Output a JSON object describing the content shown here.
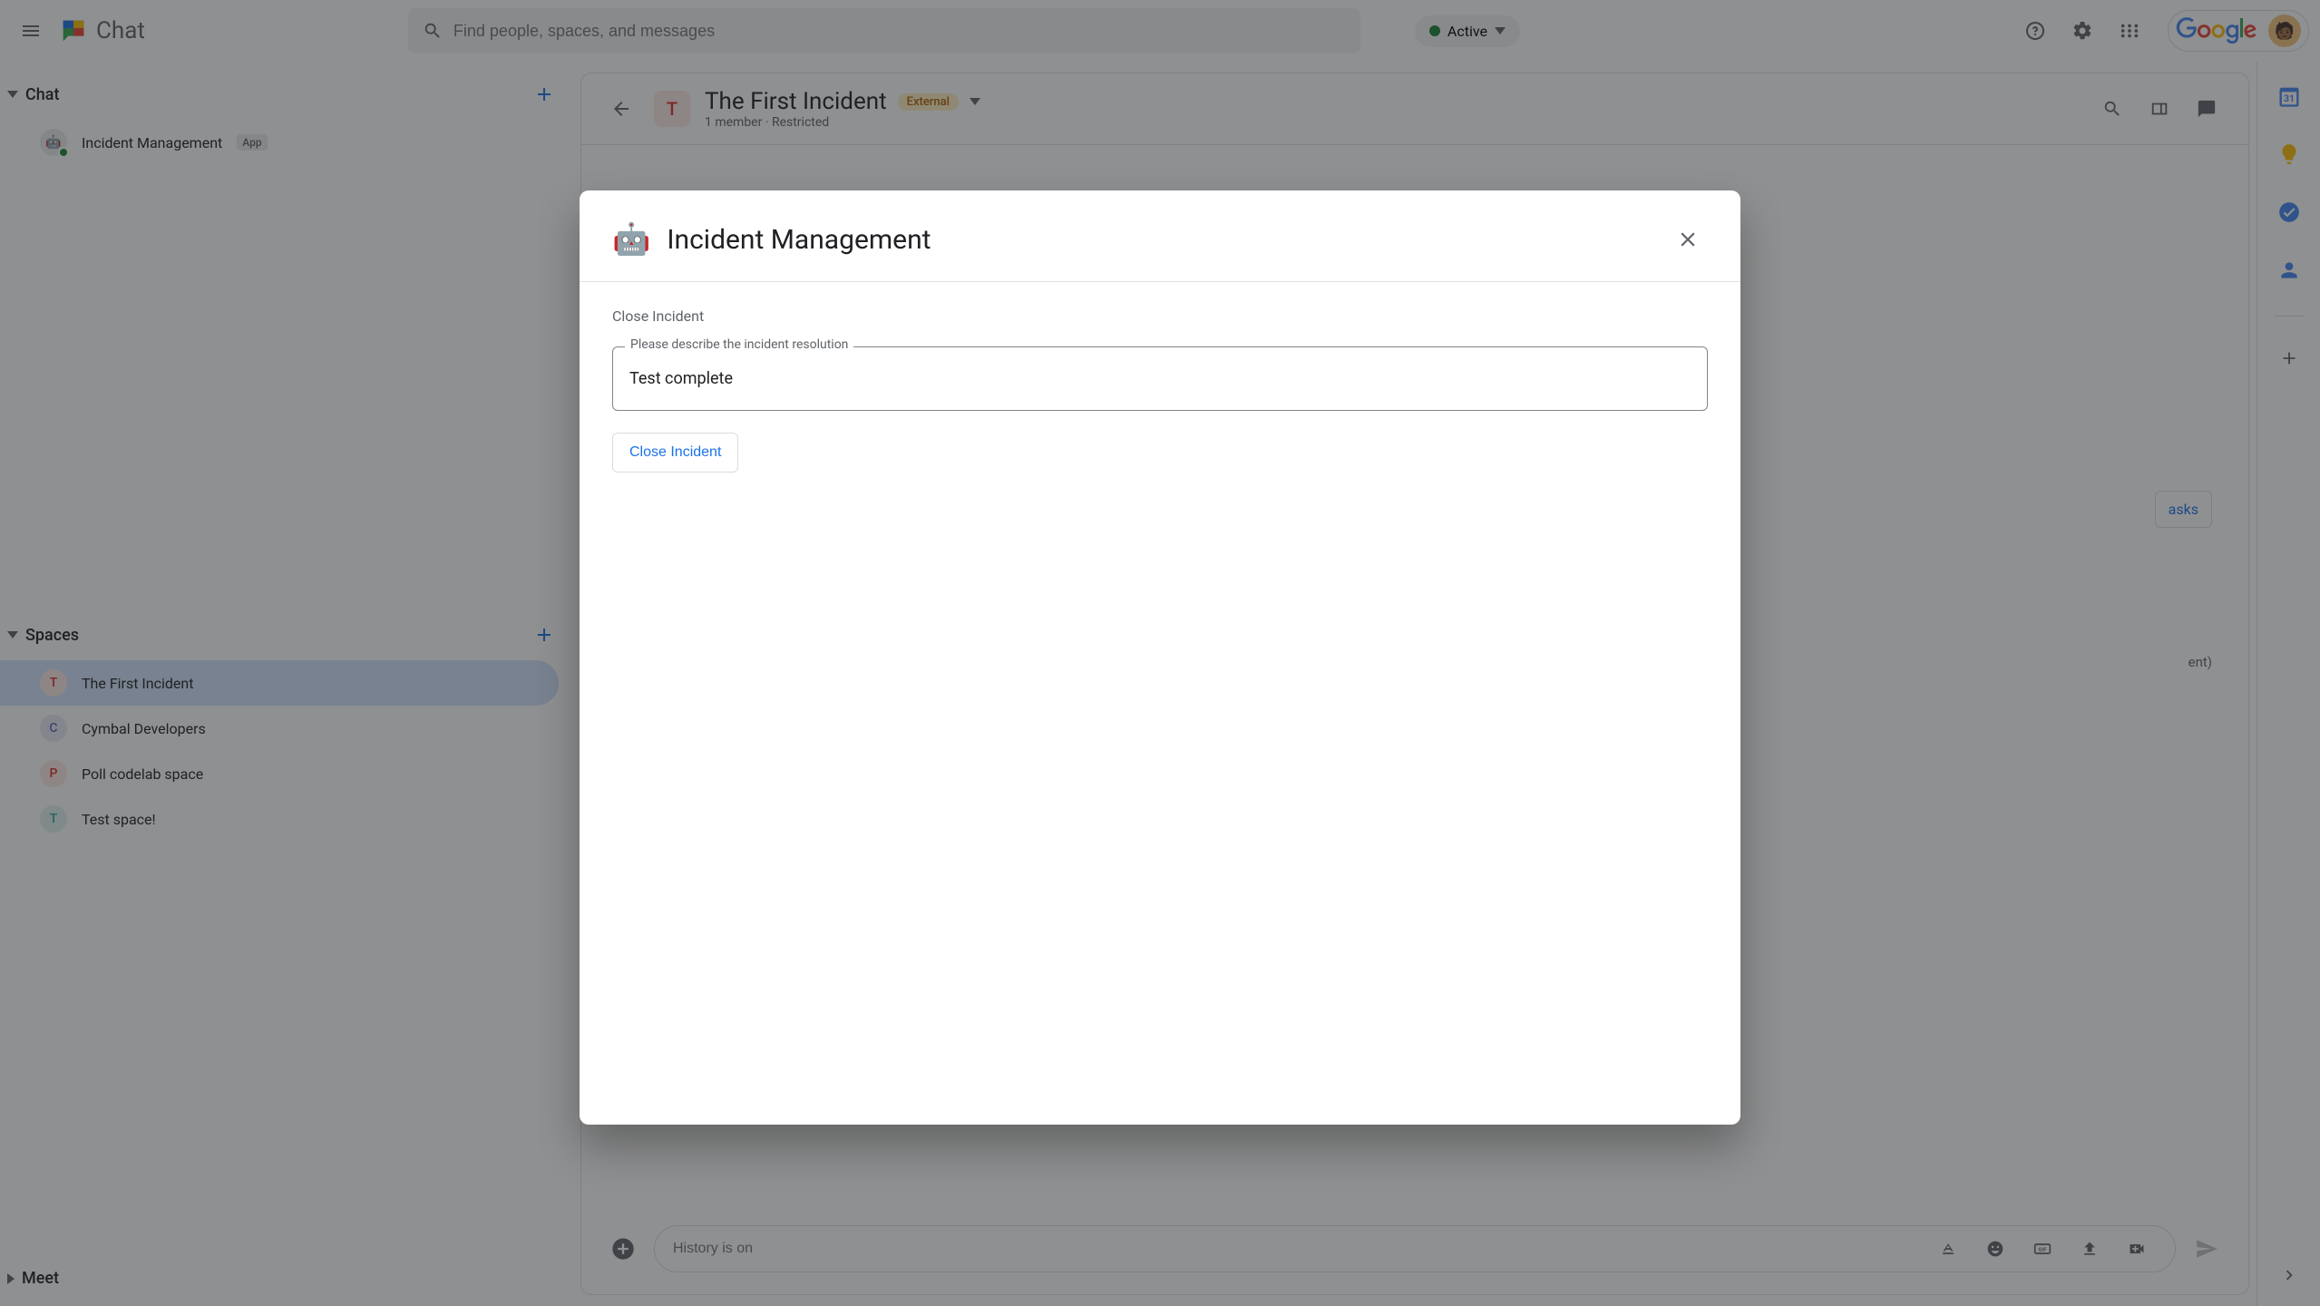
{
  "app": {
    "name": "Chat"
  },
  "search": {
    "placeholder": "Find people, spaces, and messages"
  },
  "status": {
    "label": "Active"
  },
  "sidebar": {
    "chat_section": "Chat",
    "spaces_section": "Spaces",
    "meet_section": "Meet",
    "dm": {
      "name": "Incident Management",
      "badge": "App"
    },
    "spaces": [
      {
        "initial": "T",
        "label": "The First Incident",
        "color": "#fce8e6",
        "text": "#d93025"
      },
      {
        "initial": "C",
        "label": "Cymbal Developers",
        "color": "#e8eaf6",
        "text": "#5c6bc0"
      },
      {
        "initial": "P",
        "label": "Poll codelab space",
        "color": "#fce8e6",
        "text": "#d93025"
      },
      {
        "initial": "T",
        "label": "Test space!",
        "color": "#e0f2f1",
        "text": "#26a69a"
      }
    ]
  },
  "space_header": {
    "initial": "T",
    "title": "The First Incident",
    "external": "External",
    "subtitle": "1 member  ·  Restricted"
  },
  "composer": {
    "placeholder": "History is on"
  },
  "modal": {
    "title": "Incident Management",
    "section_label": "Close Incident",
    "field_label": "Please describe the incident resolution",
    "field_value": "Test complete",
    "action_label": "Close Incident"
  },
  "side_tabs": {
    "calendar_day": "31"
  },
  "partial_text": {
    "tasks": "asks",
    "event": "ent)"
  }
}
